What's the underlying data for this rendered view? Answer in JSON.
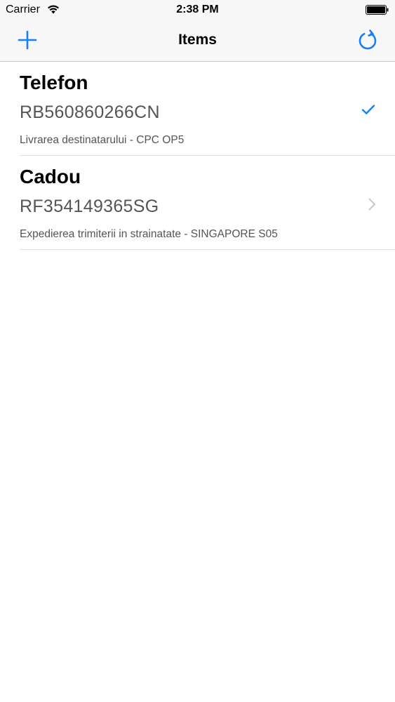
{
  "status_bar": {
    "carrier": "Carrier",
    "time": "2:38 PM",
    "wifi_icon": "wifi-icon",
    "battery_icon": "battery-icon"
  },
  "nav_bar": {
    "title": "Items",
    "left_icon": "plus-icon",
    "right_icon": "refresh-icon"
  },
  "items": [
    {
      "name": "Telefon",
      "code": "RB560860266CN",
      "status": "Livrarea destinatarului - CPC OP5",
      "accessory": "checkmark-icon"
    },
    {
      "name": "Cadou",
      "code": "RF354149365SG",
      "status": "Expedierea trimiterii in strainatate - SINGAPORE S05",
      "accessory": "chevron-right-icon"
    }
  ],
  "colors": {
    "tint": "#157efb",
    "bar_background": "#f7f7f7",
    "separator": "#e0e0e4",
    "secondary_text": "#555555",
    "chevron": "#c7c7cc"
  }
}
